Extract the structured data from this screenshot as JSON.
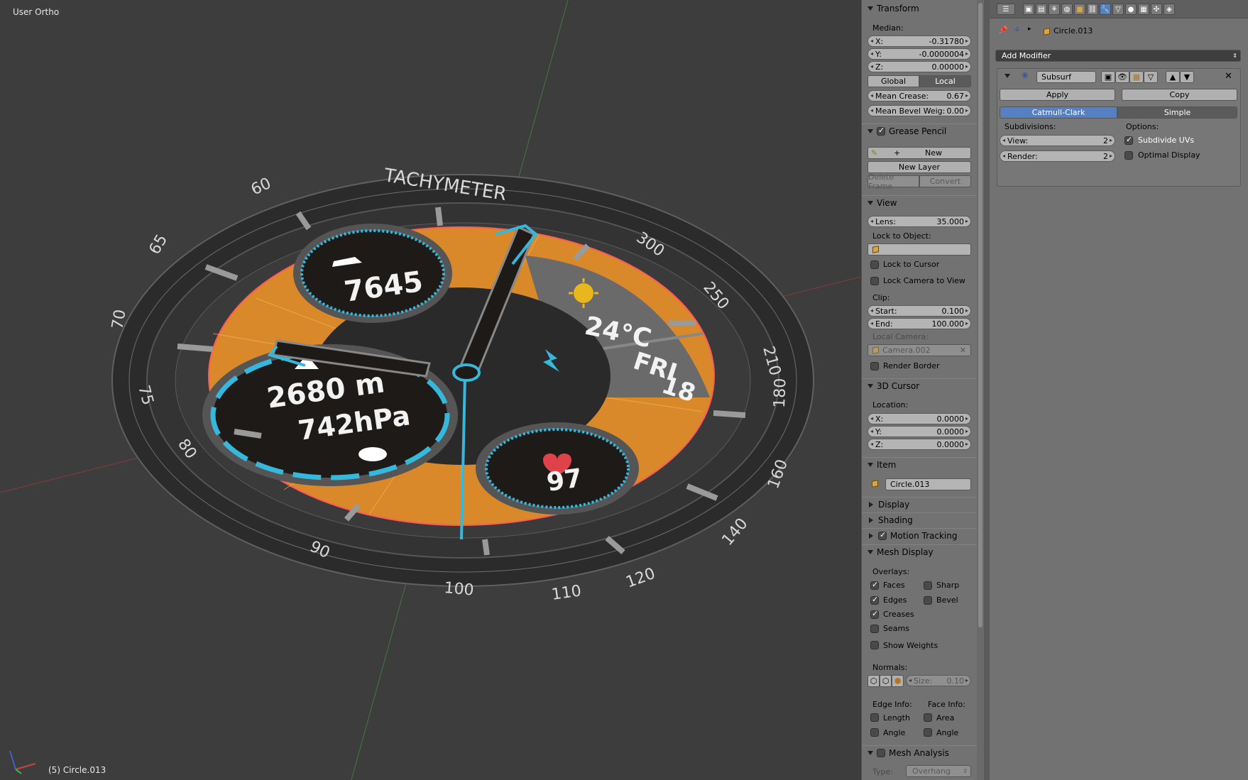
{
  "viewport": {
    "title": "User Ortho",
    "object_label": "(5) Circle.013",
    "watch": {
      "bezel_title": "TACHYMETER",
      "bezel_numbers": [
        "60",
        "65",
        "70",
        "75",
        "80",
        "90",
        "100",
        "110",
        "120",
        "140",
        "160",
        "180",
        "210",
        "250",
        "300"
      ],
      "steps_value": "7645",
      "temperature": "24°C",
      "day": "FRI",
      "date": "18",
      "altitude": "2680 m",
      "pressure": "742hPa",
      "heart_rate": "97"
    }
  },
  "npanel": {
    "transform": {
      "header": "Transform",
      "median_label": "Median:",
      "x_label": "X:",
      "x_value": "-0.31780",
      "y_label": "Y:",
      "y_value": "-0.0000004",
      "z_label": "Z:",
      "z_value": "0.00000",
      "global_label": "Global",
      "local_label": "Local",
      "mean_crease_label": "Mean Crease:",
      "mean_crease_value": "0.67",
      "mean_bevel_label": "Mean Bevel Weig:",
      "mean_bevel_value": "0.00"
    },
    "grease_pencil": {
      "header": "Grease Pencil",
      "new_label": "New",
      "new_layer_label": "New Layer",
      "delete_frame_label": "Delete Frame",
      "convert_label": "Convert"
    },
    "view": {
      "header": "View",
      "lens_label": "Lens:",
      "lens_value": "35.000",
      "lock_object_label": "Lock to Object:",
      "lock_cursor_label": "Lock to Cursor",
      "lock_camera_label": "Lock Camera to View",
      "clip_label": "Clip:",
      "start_label": "Start:",
      "start_value": "0.100",
      "end_label": "End:",
      "end_value": "100.000",
      "local_camera_label": "Local Camera:",
      "local_camera_value": "Camera.002",
      "render_border_label": "Render Border"
    },
    "cursor": {
      "header": "3D Cursor",
      "location_label": "Location:",
      "x_label": "X:",
      "x_value": "0.0000",
      "y_label": "Y:",
      "y_value": "0.0000",
      "z_label": "Z:",
      "z_value": "0.0000"
    },
    "item": {
      "header": "Item",
      "name": "Circle.013"
    },
    "display_header": "Display",
    "shading_header": "Shading",
    "motion_tracking_header": "Motion Tracking",
    "mesh_display": {
      "header": "Mesh Display",
      "overlays_label": "Overlays:",
      "faces": "Faces",
      "sharp": "Sharp",
      "edges": "Edges",
      "bevel": "Bevel",
      "creases": "Creases",
      "seams": "Seams",
      "show_weights": "Show Weights",
      "normals_label": "Normals:",
      "size_label": "Size:",
      "size_value": "0.10",
      "edge_info_label": "Edge Info:",
      "face_info_label": "Face Info:",
      "length": "Length",
      "area": "Area",
      "edge_angle": "Angle",
      "face_angle": "Angle"
    },
    "mesh_analysis": {
      "header": "Mesh Analysis",
      "type_label": "Type:",
      "type_value": "Overhang"
    }
  },
  "properties": {
    "object_name": "Circle.013",
    "add_modifier_label": "Add Modifier",
    "modifier": {
      "name": "Subsurf",
      "apply_label": "Apply",
      "copy_label": "Copy",
      "catmull_label": "Catmull-Clark",
      "simple_label": "Simple",
      "subdivisions_label": "Subdivisions:",
      "options_label": "Options:",
      "view_label": "View:",
      "view_value": "2",
      "render_label": "Render:",
      "render_value": "2",
      "subdivide_uvs_label": "Subdivide UVs",
      "optimal_display_label": "Optimal Display"
    }
  },
  "colors": {
    "viewport_bg": "#3d3d3d",
    "panel_bg": "#727272",
    "accent_blue": "#5680c2",
    "watch_orange": "#d9892a",
    "watch_cyan": "#36b7dc"
  }
}
